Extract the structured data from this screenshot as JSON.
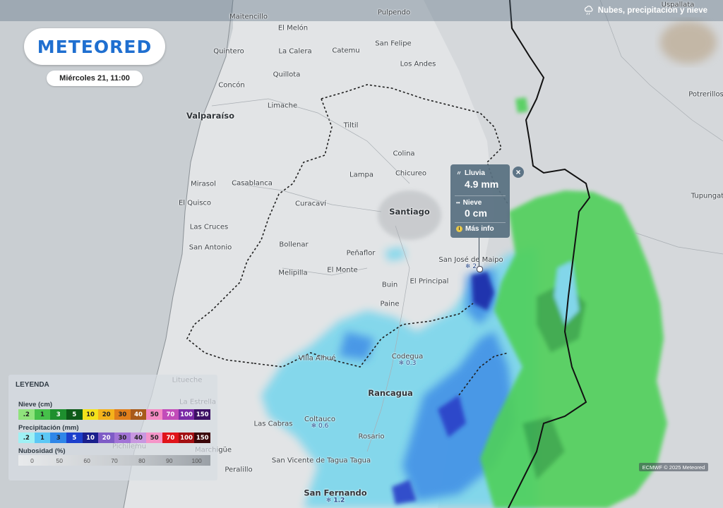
{
  "header": {
    "logo": "METEORED",
    "datetime": "Miércoles 21, 11:00",
    "layer_title": "Nubes, precipitación y nieve",
    "layer_icon": "cloud-rain-icon"
  },
  "popup": {
    "rain_label": "Lluvia",
    "rain_value": "4.9 mm",
    "snow_label": "Nieve",
    "snow_value": "0 cm",
    "more_info": "Más info",
    "close_icon": "close-icon"
  },
  "places": [
    {
      "name": "Maitencillo"
    },
    {
      "name": "Pulpendo"
    },
    {
      "name": "El Melón"
    },
    {
      "name": "Quintero"
    },
    {
      "name": "La Calera"
    },
    {
      "name": "Catemu"
    },
    {
      "name": "San Felipe"
    },
    {
      "name": "Los Andes"
    },
    {
      "name": "Quillota"
    },
    {
      "name": "Concón"
    },
    {
      "name": "Limache"
    },
    {
      "name": "Valparaíso"
    },
    {
      "name": "Tiltil"
    },
    {
      "name": "Colina"
    },
    {
      "name": "Lampa"
    },
    {
      "name": "Chicureo"
    },
    {
      "name": "Santiago"
    },
    {
      "name": "Casablanca"
    },
    {
      "name": "Mirasol"
    },
    {
      "name": "El Quisco"
    },
    {
      "name": "Curacaví"
    },
    {
      "name": "Las Cruces"
    },
    {
      "name": "San Antonio"
    },
    {
      "name": "Bollenar"
    },
    {
      "name": "Peñaflor"
    },
    {
      "name": "Melipilla"
    },
    {
      "name": "El Monte"
    },
    {
      "name": "El Principal"
    },
    {
      "name": "San José de Maipo"
    },
    {
      "name": "Buin"
    },
    {
      "name": "Paine"
    },
    {
      "name": "Villa Alhué"
    },
    {
      "name": "Codegua"
    },
    {
      "name": "Rancagua"
    },
    {
      "name": "Las Cabras"
    },
    {
      "name": "Coltauco"
    },
    {
      "name": "Rosario"
    },
    {
      "name": "San Vicente de Tagua Tagua"
    },
    {
      "name": "Peralillo"
    },
    {
      "name": "San Fernando"
    },
    {
      "name": "Litueche"
    },
    {
      "name": "La Estrella"
    },
    {
      "name": "Pichilemu"
    },
    {
      "name": "Marchigüe"
    },
    {
      "name": "Uspallata"
    },
    {
      "name": "Potrerillos"
    },
    {
      "name": "Tupungato"
    }
  ],
  "snow_values": [
    {
      "name": "San José de Maipo",
      "value": "2"
    },
    {
      "name": "Codegua",
      "value": "0.3"
    },
    {
      "name": "Coltauco",
      "value": "0.6"
    },
    {
      "name": "San Fernando",
      "value": "1.2"
    }
  ],
  "legend": {
    "title": "LEYENDA",
    "snow": {
      "title": "Nieve (cm)",
      "start": ".2",
      "values": [
        "1",
        "3",
        "5",
        "10",
        "20",
        "30",
        "40",
        "50",
        "70",
        "100",
        "150"
      ],
      "colors": [
        "#8fe37c",
        "#46c04a",
        "#1e8f2e",
        "#0d5a18",
        "#f4e21b",
        "#f4b21b",
        "#e07e1a",
        "#a85a1a",
        "#f58ac3",
        "#c24cb9",
        "#7b2aa6",
        "#3c1064"
      ]
    },
    "precip": {
      "title": "Precipitación (mm)",
      "start": ".2",
      "values": [
        "1",
        "3",
        "5",
        "10",
        "20",
        "30",
        "40",
        "50",
        "70",
        "100",
        "150"
      ],
      "colors": [
        "#9ff0f4",
        "#5cc8f5",
        "#2f86e8",
        "#1c3fcc",
        "#1a1f8c",
        "#7e5cc6",
        "#a274d6",
        "#c898e0",
        "#f595c8",
        "#e0141a",
        "#a30f12",
        "#3a0508"
      ]
    },
    "cloud": {
      "title": "Nubosidad (%)",
      "values": [
        "0",
        "50",
        "60",
        "70",
        "80",
        "90",
        "100"
      ]
    }
  },
  "credit": "ECMWF © 2025 Meteored"
}
